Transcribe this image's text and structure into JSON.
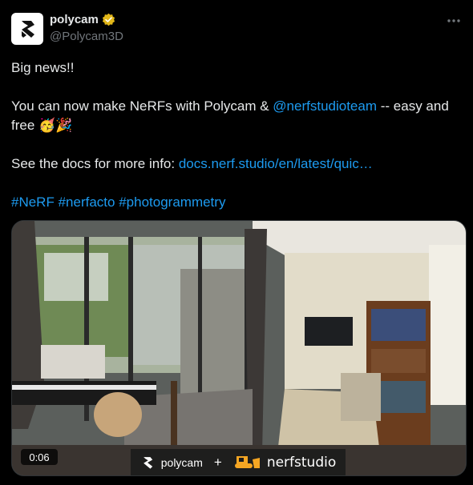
{
  "author": {
    "display_name": "polycam",
    "handle": "@Polycam3D",
    "verified_icon": "verified-badge-gold-icon",
    "avatar_icon": "polycam-logo-icon"
  },
  "tweet": {
    "line1": "Big news!!",
    "line2_prefix": "You can now make NeRFs with Polycam & ",
    "mention": "@nerfstudioteam",
    "line2_suffix": " -- easy and",
    "line3_text": "free ",
    "line3_emojis": "🥳🎉",
    "line4_prefix": "See the docs for more info: ",
    "docs_link": "docs.nerf.studio/en/latest/quic…",
    "hashtags": [
      "#NeRF",
      "#nerfacto",
      "#photogrammetry"
    ]
  },
  "media": {
    "duration": "0:06",
    "overlay_brand_left": "polycam",
    "overlay_plus": "+",
    "overlay_brand_right": "nerfstudio"
  },
  "colors": {
    "background": "#000000",
    "text": "#e7e9ea",
    "secondary_text": "#71767b",
    "link": "#1d9bf0",
    "verified": "#e2b719"
  }
}
